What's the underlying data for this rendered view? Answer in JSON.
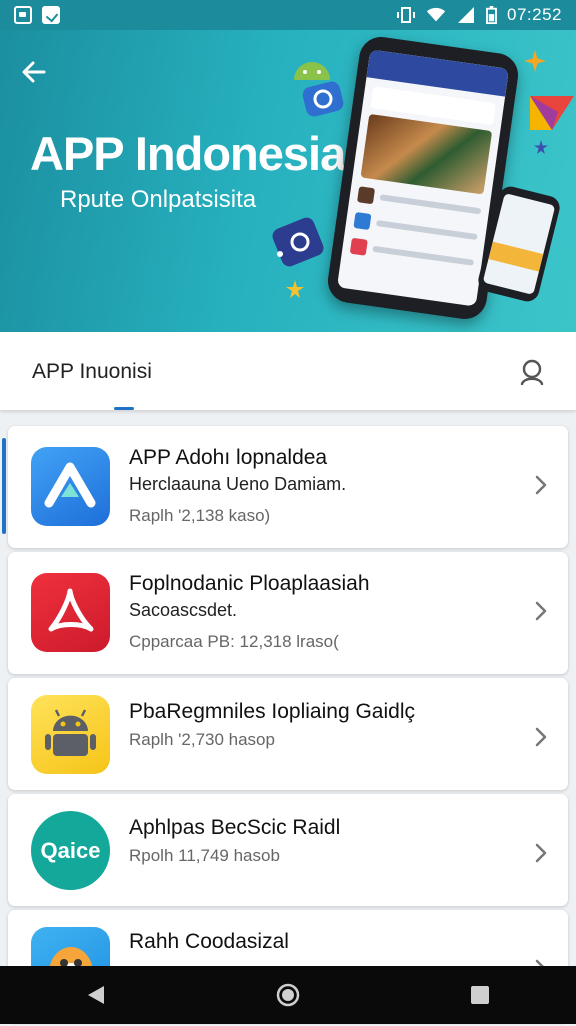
{
  "status_bar": {
    "time": "07:252"
  },
  "hero": {
    "title": "APP Indonesia",
    "subtitle": "Rpute Onlpatsisita"
  },
  "search": {
    "title": "APP Inuonisi"
  },
  "apps": [
    {
      "title": "APP Adohı lopnaldea",
      "subtitle": "Herclaauna Ueno Damiam.",
      "meta": "Raplh '2,138 kaso)",
      "icon": "app-a-icon"
    },
    {
      "title": "Foplnodanic Ploaplaasiah",
      "subtitle": "Sacoascsdet.",
      "meta": "Cpparcaa PB: 12,318 lraso(",
      "icon": "acrobat-icon"
    },
    {
      "title": "PbaRegmniles Iopliaing Gaidlç",
      "meta": "Raplh '2,730 hasop",
      "icon": "android-icon"
    },
    {
      "title": "Aphlpas BecScic Raidl",
      "meta": "Rpolh 11,749 hasob",
      "icon": "gaice-logo-icon",
      "logo_text": "Qaice"
    },
    {
      "title": "Rahh Coodasizal",
      "icon": "mascot-icon"
    }
  ],
  "colors": {
    "accent": "#1f73c7",
    "hero_start": "#1b8fa0",
    "hero_end": "#3cc5c9",
    "navbar": "#0a0a0a"
  }
}
